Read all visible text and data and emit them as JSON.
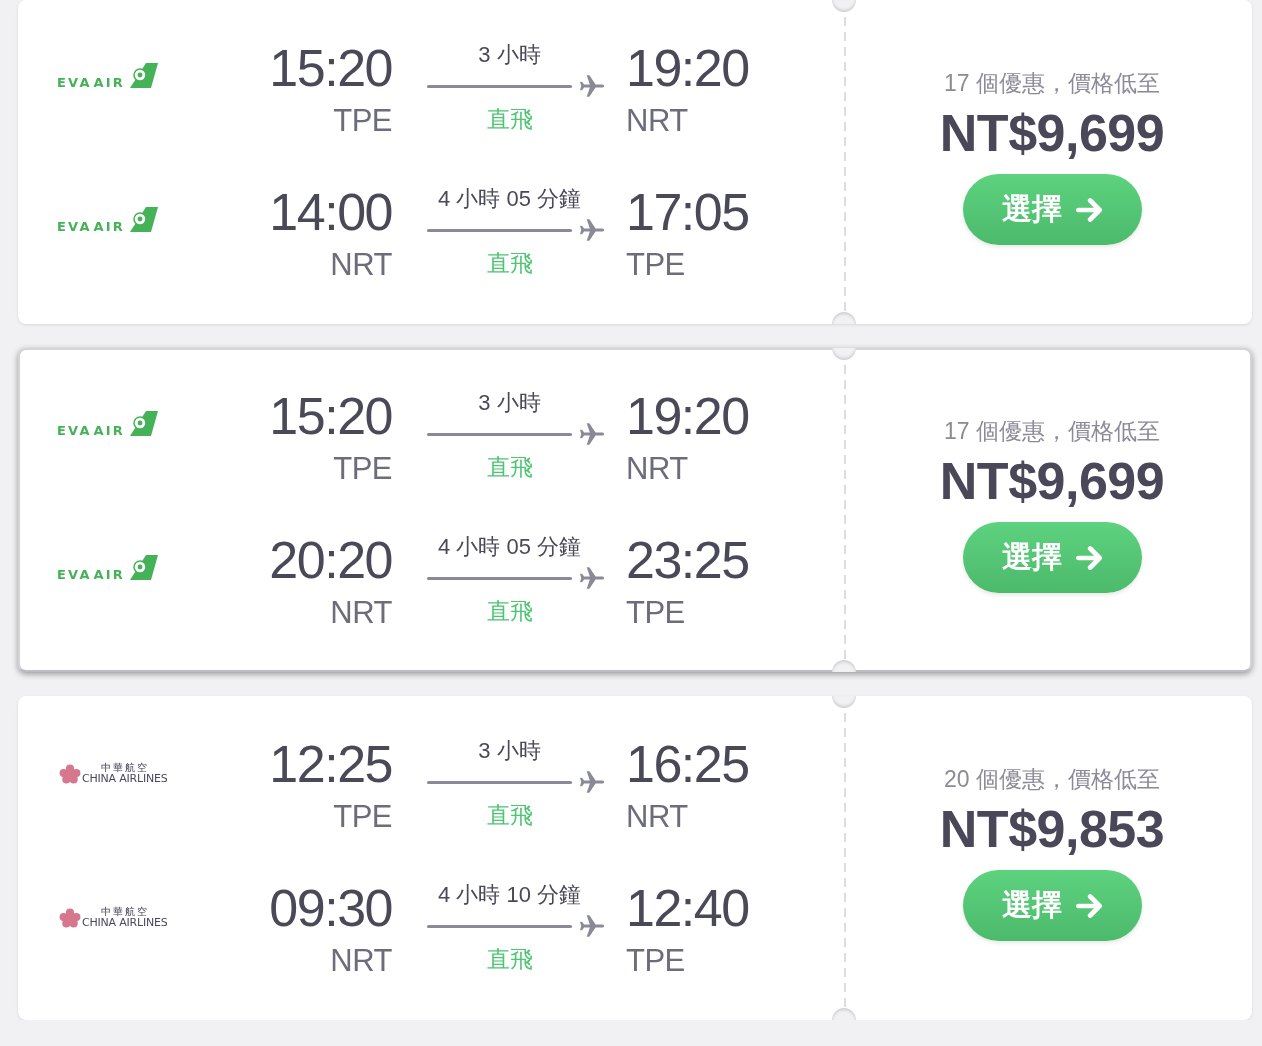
{
  "offers": [
    {
      "highlighted": false,
      "legs": [
        {
          "airline": {
            "kind": "eva",
            "name": "EVA AIR"
          },
          "depart_time": "15:20",
          "depart_airport": "TPE",
          "duration": "3 小時",
          "stops": "直飛",
          "arrive_time": "19:20",
          "arrive_airport": "NRT"
        },
        {
          "airline": {
            "kind": "eva",
            "name": "EVA AIR"
          },
          "depart_time": "14:00",
          "depart_airport": "NRT",
          "duration": "4 小時 05 分鐘",
          "stops": "直飛",
          "arrive_time": "17:05",
          "arrive_airport": "TPE"
        }
      ],
      "deals_text": "17 個優惠，價格低至",
      "price": "NT$9,699",
      "button": "選擇"
    },
    {
      "highlighted": true,
      "legs": [
        {
          "airline": {
            "kind": "eva",
            "name": "EVA AIR"
          },
          "depart_time": "15:20",
          "depart_airport": "TPE",
          "duration": "3 小時",
          "stops": "直飛",
          "arrive_time": "19:20",
          "arrive_airport": "NRT"
        },
        {
          "airline": {
            "kind": "eva",
            "name": "EVA AIR"
          },
          "depart_time": "20:20",
          "depart_airport": "NRT",
          "duration": "4 小時 05 分鐘",
          "stops": "直飛",
          "arrive_time": "23:25",
          "arrive_airport": "TPE"
        }
      ],
      "deals_text": "17 個優惠，價格低至",
      "price": "NT$9,699",
      "button": "選擇"
    },
    {
      "highlighted": false,
      "legs": [
        {
          "airline": {
            "kind": "china",
            "name_zh": "中華航空",
            "name": "CHINA AIRLINES"
          },
          "depart_time": "12:25",
          "depart_airport": "TPE",
          "duration": "3 小時",
          "stops": "直飛",
          "arrive_time": "16:25",
          "arrive_airport": "NRT"
        },
        {
          "airline": {
            "kind": "china",
            "name_zh": "中華航空",
            "name": "CHINA AIRLINES"
          },
          "depart_time": "09:30",
          "depart_airport": "NRT",
          "duration": "4 小時 10 分鐘",
          "stops": "直飛",
          "arrive_time": "12:40",
          "arrive_airport": "TPE"
        }
      ],
      "deals_text": "20 個優惠，價格低至",
      "price": "NT$9,853",
      "button": "選擇"
    }
  ]
}
